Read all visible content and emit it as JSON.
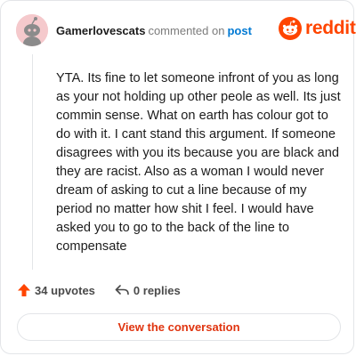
{
  "comment": {
    "author": "Gamerlovescats",
    "action_text": "commented on",
    "target_link": "post",
    "body": "YTA. Its fine to let someone infront of you as long as your not holding up other peole as well. Its just commin sense. What on earth has colour got to do with it. I cant stand this argument. If someone disagrees with you its because you are black and they are racist. Also as a woman I would never dream of asking to cut a line because of my period no matter how shit I feel. I would have asked you to go to the back of the line to compensate",
    "upvotes_label": "34 upvotes",
    "replies_label": "0 replies"
  },
  "brand": {
    "name": "reddit",
    "color": "#ff4500"
  },
  "footer": {
    "view_button_label": "View the conversation"
  },
  "icons": {
    "avatar": "snoo-avatar-icon",
    "logo": "reddit-logo-icon",
    "upvote": "upvote-arrow-icon",
    "reply": "reply-arrow-icon"
  },
  "colors": {
    "accent": "#ff4500",
    "link": "#0079d3",
    "button_text": "#e0340f",
    "avatar_bg": "#f5c9cc"
  }
}
